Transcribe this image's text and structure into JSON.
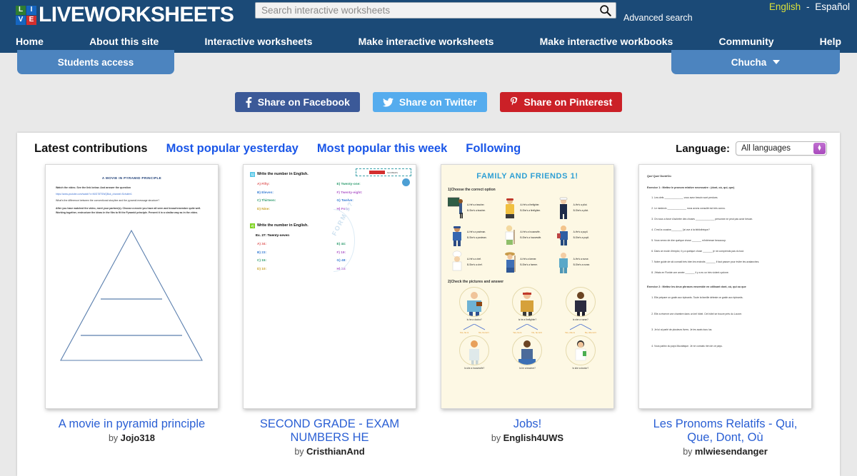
{
  "header": {
    "logo_text": "LIVEWORKSHEETS",
    "logo_squares": [
      {
        "letter": "L",
        "color": "#2f7d32"
      },
      {
        "letter": "I",
        "color": "#1565c0"
      },
      {
        "letter": "V",
        "color": "#1565c0"
      },
      {
        "letter": "E",
        "color": "#d32f2f"
      }
    ],
    "search": {
      "placeholder": "Search interactive worksheets",
      "value": "",
      "icon": "search-icon"
    },
    "advanced_search": "Advanced search",
    "language_english": "English",
    "language_separator": "-",
    "language_spanish": "Español"
  },
  "nav": {
    "items": [
      {
        "label": "Home"
      },
      {
        "label": "About this site"
      },
      {
        "label": "Interactive worksheets"
      },
      {
        "label": "Make interactive worksheets"
      },
      {
        "label": "Make interactive workbooks"
      },
      {
        "label": "Community"
      },
      {
        "label": "Help"
      }
    ]
  },
  "subbar": {
    "students_access": "Students access",
    "user_name": "Chucha",
    "user_caret": "chevron-down-icon"
  },
  "share": {
    "facebook": "Share on Facebook",
    "twitter": "Share on Twitter",
    "pinterest": "Share on Pinterest",
    "facebook_color": "#3b5998",
    "twitter_color": "#55acee",
    "pinterest_color": "#cb2027"
  },
  "tabs": [
    {
      "label": "Latest contributions",
      "active": true
    },
    {
      "label": "Most popular yesterday",
      "active": false
    },
    {
      "label": "Most popular this week",
      "active": false
    },
    {
      "label": "Following",
      "active": false
    }
  ],
  "language_filter": {
    "label": "Language:",
    "selected": "All languages"
  },
  "cards": [
    {
      "title": "A movie in pyramid principle",
      "by_prefix": "by ",
      "author": "Jojo318",
      "worksheet": {
        "heading": "A MOVIE IN PYRAMID PRINCIPLE",
        "line1": "Watch the video. See the link below. And answer the question",
        "link": "https://www.youtube.com/watch?v=N0G78TSWQBuk_channel=Schulter1",
        "line2": "What's the difference between the conventional storyline and the pyramid message structure?",
        "line3": "After you have watched the video, meet your partner(s). Choose a movie you have all seen and know/remember quite well. Working together, restructure the ideas in the film to fit the Pyramid principle. Present it in a similar way as in the video."
      }
    },
    {
      "title": "SECOND GRADE - EXAM NUMBERS HE",
      "by_prefix": "by ",
      "author": "CristhianAnd",
      "worksheet": {
        "header_label": "NUMBERS",
        "q1_num": "1)",
        "q1": "Write the number in English.",
        "q1_left": [
          "A) Fifty:",
          "B) Eleven:",
          "C) Thirteen:",
          "D) Nine:"
        ],
        "q1_right": [
          "E) Twenty-one:",
          "F) Twenty-eight:",
          "G) Twelve:",
          "H) Four:"
        ],
        "q2_num": "2)",
        "q2": "Write the number in English.",
        "example": "Ex.  27:  Twenty-seven",
        "q2_left": [
          "A) 34:",
          "B) 23:",
          "C) 15:",
          "D) 10:"
        ],
        "q2_right": [
          "E) 44:",
          "F) 19:",
          "G) 48:",
          "H) 20:"
        ],
        "watermark": "FORM 5?"
      }
    },
    {
      "title": "Jobs!",
      "by_prefix": "by ",
      "author": "English4UWS",
      "worksheet": {
        "heading": "FAMILY AND FRIENDS 1!",
        "q1": "1)Choose the correct option",
        "options": [
          {
            "a": "A-He's a teacher.",
            "b": "B-She's a teacher."
          },
          {
            "a": "A-He's a firefighter.",
            "b": "B-She's a firefighter."
          },
          {
            "a": "A-He's a pilot.",
            "b": "B-She's a pilot."
          },
          {
            "a": "A-He's a postman.",
            "b": "B-She's a postman."
          },
          {
            "a": "A-He's a housewife.",
            "b": "B-She's a housewife."
          },
          {
            "a": "A-He's a pupil.",
            "b": "B-She's a pupil."
          },
          {
            "a": "A-He's a chef.",
            "b": "B-She's a chef."
          },
          {
            "a": "A-He's a farmer.",
            "b": "B-She's a farmer."
          },
          {
            "a": "A-He's a nurse.",
            "b": "B-She's a nurse."
          }
        ],
        "q2": "2)Check the pictures and answer",
        "questions": [
          {
            "q": "Is he a doctor?",
            "yes": "Yes, he is",
            "no": "No, he isn't"
          },
          {
            "q": "Is he a firefighter?",
            "yes": "Yes, he is",
            "no": "No, he isn't"
          },
          {
            "q": "Is she a nurse?",
            "yes": "Yes, she is",
            "no": "No, she isn't"
          },
          {
            "q": "Is she a housewife?",
            "yes": "",
            "no": ""
          },
          {
            "q": "Is he a teacher?",
            "yes": "",
            "no": ""
          },
          {
            "q": "Is she a doctor?",
            "yes": "",
            "no": ""
          }
        ]
      }
    },
    {
      "title": "Les Pronoms Relatifs - Qui, Que, Dont, Où",
      "by_prefix": "by ",
      "author": "mlwiesendanger",
      "worksheet": {
        "heading": "Qui/ Que/ Dont/Où",
        "exercise1": "Exercice 1 :  Mettez le pronom relative necessaire : (dont, où, qui, que)",
        "items1": [
          "Les clefs ______________ vous avez besoin sont perdues.",
          "Le medecin ______________ nous avons consulté est très connu.",
          "On nous a forcé d'acheter des choses ______________ personne ne peut pas avoir besoin.",
          "C'est la cousine________  j'ai vue à la bibliothèque?",
          "Vous venez de dire quelque chose _______  m'intéresse beaucoup.",
          "Dans ce mode d'emploi, il y a quelque chose _______ je ne comprends pas du tout.",
          "Notre guide de ski connaît très bien les endroits _______ il faut passer pour éviter les avalanches.",
          "J'étais en Floride une année _______ il y a eu un très violent cyclone."
        ],
        "exercise2": "Exercice 2 :  Mettez les deux phrases ensemble en utilisant dont, où, qui ou que",
        "items2": [
          "Elle prépare un gratin aux épinards. Toute la famille déteste ce gratin aux épinards.",
          "Elle a réservé une chambre dans un bel hôtel. Cet hôtel se trouve près du Louvre.",
          "Je lui ai parlé de plusieurs livres. Je les avais tous lus.",
          "Vous parlez du pays Mozabique. Je ne connais rien de ce pays."
        ]
      }
    }
  ],
  "colors": {
    "header_bg": "#1b4a77",
    "pill_bg": "#4c84bf",
    "page_bg": "#e9e9e9",
    "link_blue": "#2a5fd4",
    "tab_link": "#1a56e8"
  }
}
